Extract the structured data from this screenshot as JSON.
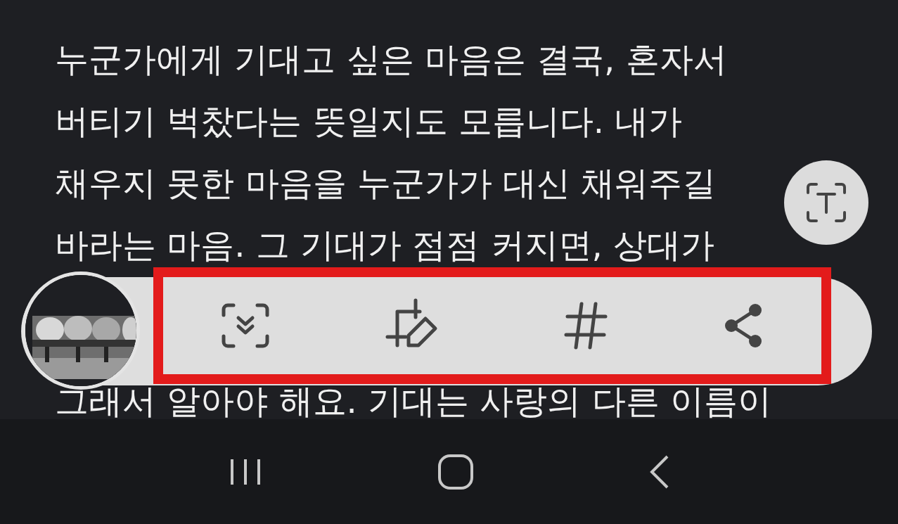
{
  "article": {
    "lines": [
      {
        "text": "누군가에게 기대고 싶은 마음은 결국, 혼자서",
        "below_toolbar": false
      },
      {
        "text": "버티기 벅찼다는 뜻일지도 모릅니다. 내가",
        "below_toolbar": false
      },
      {
        "text": "채우지 못한 마음을 누군가가 대신 채워주길",
        "below_toolbar": false
      },
      {
        "text": "바라는 마음. 그 기대가 점점 커지면, 상대가",
        "below_toolbar": false
      },
      {
        "text": "그래서 알아야 해요. 기대는 사랑의 다른 이름이",
        "below_toolbar": true
      }
    ]
  },
  "screenshot_toolbar": {
    "highlighted": true
  }
}
